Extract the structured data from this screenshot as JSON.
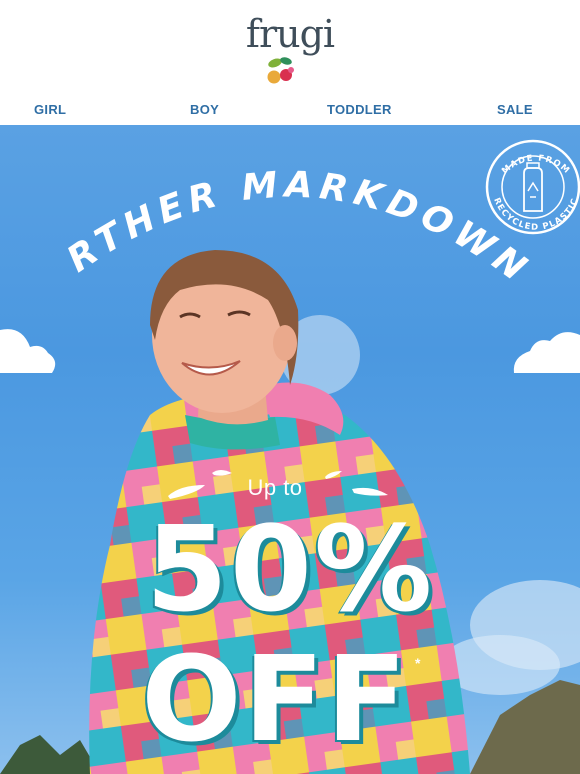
{
  "header": {
    "logo_text": "frugi"
  },
  "nav": {
    "items": [
      {
        "label": "GIRL"
      },
      {
        "label": "BOY"
      },
      {
        "label": "TODDLER"
      },
      {
        "label": "SALE"
      }
    ]
  },
  "hero": {
    "headline": "FURTHER MARKDOWNS",
    "badge_top": "MADE FROM",
    "badge_bottom": "RECYCLED PLASTIC",
    "badge_icon": "recycled-bottle-icon",
    "offer_prefix": "Up to",
    "offer_amount": "50%",
    "offer_suffix": "OFF",
    "asterisk": "*"
  },
  "colors": {
    "sky": "#4b98e0",
    "nav_text": "#2f6ea5",
    "logo_text": "#3f4e5a",
    "text_shadow": "#1d8b9b"
  }
}
